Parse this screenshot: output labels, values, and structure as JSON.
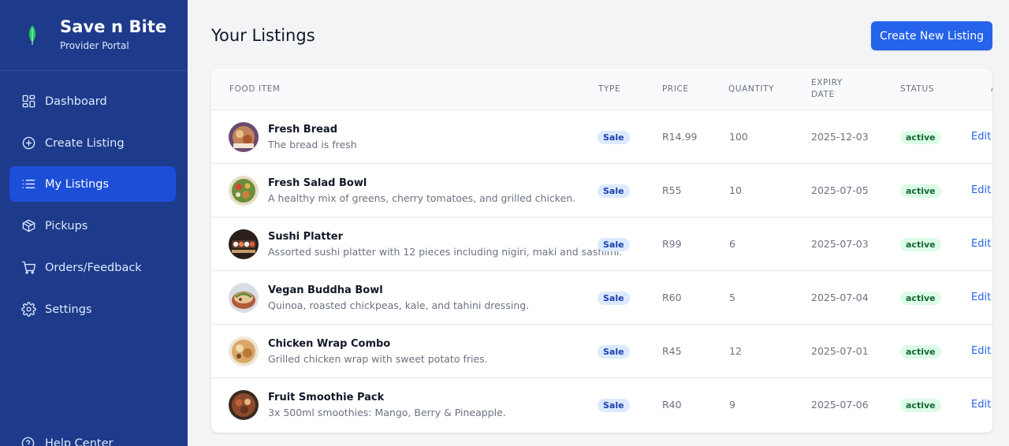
{
  "brand": {
    "title": "Save n Bite",
    "subtitle": "Provider Portal",
    "logo_icon": "leaf-icon"
  },
  "sidebar": {
    "items": [
      {
        "label": "Dashboard",
        "icon": "dashboard-grid-icon",
        "active": false
      },
      {
        "label": "Create Listing",
        "icon": "plus-circle-icon",
        "active": false
      },
      {
        "label": "My Listings",
        "icon": "list-icon",
        "active": true
      },
      {
        "label": "Pickups",
        "icon": "package-icon",
        "active": false
      },
      {
        "label": "Orders/Feedback",
        "icon": "shopping-cart-icon",
        "active": false
      },
      {
        "label": "Settings",
        "icon": "gear-icon",
        "active": false
      }
    ],
    "help_label": "Help Center"
  },
  "header": {
    "title": "Your Listings",
    "create_button": "Create New Listing"
  },
  "table": {
    "columns": {
      "food_item": "Food Item",
      "type": "Type",
      "price": "Price",
      "quantity": "Quantity",
      "expiry_line1": "Expiry",
      "expiry_line2": "Date",
      "status": "Status",
      "actions": "A"
    },
    "rows": [
      {
        "name": "Fresh Bread",
        "description": "The bread is fresh",
        "type": "Sale",
        "price": "R14.99",
        "quantity": "100",
        "expiry": "2025-12-03",
        "status": "active",
        "action": "Edit"
      },
      {
        "name": "Fresh Salad Bowl",
        "description": "A healthy mix of greens, cherry tomatoes, and grilled chicken.",
        "type": "Sale",
        "price": "R55",
        "quantity": "10",
        "expiry": "2025-07-05",
        "status": "active",
        "action": "Edit"
      },
      {
        "name": "Sushi Platter",
        "description": "Assorted sushi platter with 12 pieces including nigiri, maki and sashimi.",
        "type": "Sale",
        "price": "R99",
        "quantity": "6",
        "expiry": "2025-07-03",
        "status": "active",
        "action": "Edit"
      },
      {
        "name": "Vegan Buddha Bowl",
        "description": "Quinoa, roasted chickpeas, kale, and tahini dressing.",
        "type": "Sale",
        "price": "R60",
        "quantity": "5",
        "expiry": "2025-07-04",
        "status": "active",
        "action": "Edit"
      },
      {
        "name": "Chicken Wrap Combo",
        "description": "Grilled chicken wrap with sweet potato fries.",
        "type": "Sale",
        "price": "R45",
        "quantity": "12",
        "expiry": "2025-07-01",
        "status": "active",
        "action": "Edit"
      },
      {
        "name": "Fruit Smoothie Pack",
        "description": "3x 500ml smoothies: Mango, Berry & Pineapple.",
        "type": "Sale",
        "price": "R40",
        "quantity": "9",
        "expiry": "2025-07-06",
        "status": "active",
        "action": "Edit"
      }
    ]
  },
  "colors": {
    "sidebar_bg": "#1e3a8a",
    "active_nav": "#1d4ed8",
    "primary": "#2563eb",
    "type_badge_bg": "#dbeafe",
    "status_badge_bg": "#dcfce7"
  }
}
